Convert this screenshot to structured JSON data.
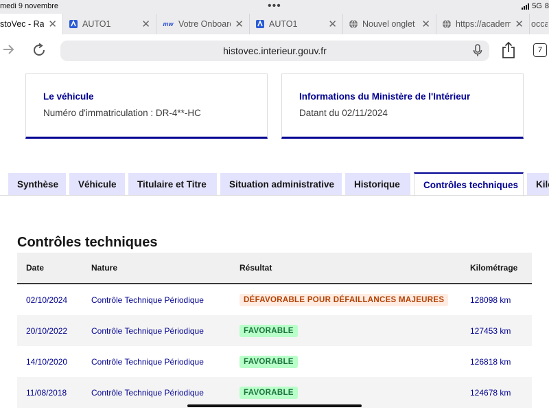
{
  "status_bar": {
    "date": "medi 9 novembre",
    "network": "5G",
    "battery": "8"
  },
  "browser_tabs": [
    {
      "title": "stoVec - Rapp",
      "favicon": "none",
      "active": true
    },
    {
      "title": "AUTO1",
      "favicon": "auto1-icon",
      "active": false
    },
    {
      "title": "Votre Onboardi",
      "favicon": "mw-icon",
      "favicon_text": "mw",
      "active": false
    },
    {
      "title": "AUTO1",
      "favicon": "auto1-icon",
      "active": false
    },
    {
      "title": "Nouvel onglet",
      "favicon": "globe-icon",
      "active": false
    },
    {
      "title": "https://academ",
      "favicon": "globe-icon",
      "active": false
    },
    {
      "title": "occa",
      "favicon": "none",
      "active": false
    }
  ],
  "address_bar": {
    "url": "histovec.interieur.gouv.fr",
    "tab_count": "7"
  },
  "cards": {
    "vehicle": {
      "title": "Le véhicule",
      "text": "Numéro d'immatriculation : DR-4**-HC"
    },
    "ministry": {
      "title": "Informations du Ministère de l'Intérieur",
      "text": "Datant du 02/11/2024"
    }
  },
  "page_tabs": [
    {
      "label": "Synthèse"
    },
    {
      "label": "Véhicule"
    },
    {
      "label": "Titulaire et Titre"
    },
    {
      "label": "Situation administrative"
    },
    {
      "label": "Historique"
    },
    {
      "label": "Contrôles techniques",
      "active": true
    },
    {
      "label": "Kilo"
    }
  ],
  "section": {
    "title": "Contrôles techniques",
    "columns": [
      "Date",
      "Nature",
      "Résultat",
      "Kilométrage"
    ],
    "rows": [
      {
        "date": "02/10/2024",
        "nature": "Contrôle Technique Périodique",
        "result": "DÉFAVORABLE POUR DÉFAILLANCES MAJEURES",
        "status": "bad",
        "km": "128098 km"
      },
      {
        "date": "20/10/2022",
        "nature": "Contrôle Technique Périodique",
        "result": "FAVORABLE",
        "status": "good",
        "km": "127453 km"
      },
      {
        "date": "14/10/2020",
        "nature": "Contrôle Technique Périodique",
        "result": "FAVORABLE",
        "status": "good",
        "km": "126818 km"
      },
      {
        "date": "11/08/2018",
        "nature": "Contrôle Technique Périodique",
        "result": "FAVORABLE",
        "status": "good",
        "km": "124678 km"
      }
    ]
  },
  "colors": {
    "primary": "#000091",
    "tab_bg": "#e3e3fd",
    "bad_bg": "#feece2",
    "bad_text": "#b34000",
    "good_bg": "#b8fec9",
    "good_text": "#18753c"
  }
}
